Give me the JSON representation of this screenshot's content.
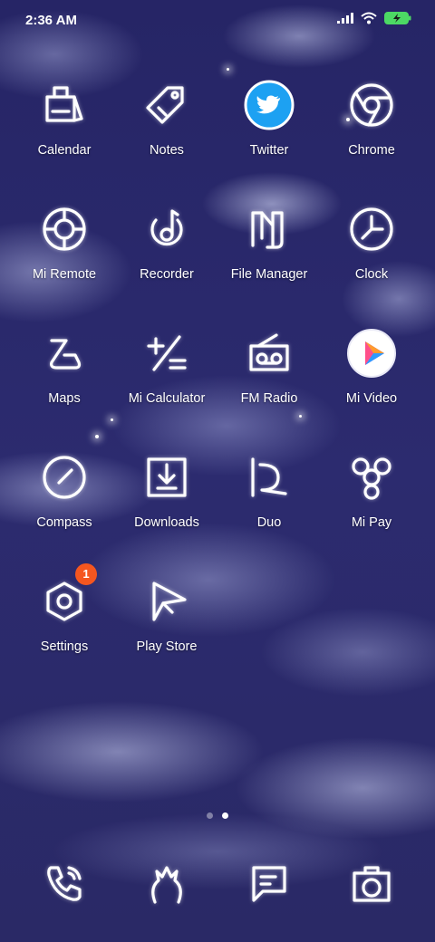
{
  "status_bar": {
    "time": "2:36 AM"
  },
  "apps": [
    {
      "label": "Calendar"
    },
    {
      "label": "Notes"
    },
    {
      "label": "Twitter"
    },
    {
      "label": "Chrome"
    },
    {
      "label": "Mi Remote"
    },
    {
      "label": "Recorder"
    },
    {
      "label": "File Manager"
    },
    {
      "label": "Clock"
    },
    {
      "label": "Maps"
    },
    {
      "label": "Mi Calculator"
    },
    {
      "label": "FM Radio"
    },
    {
      "label": "Mi Video"
    },
    {
      "label": "Compass"
    },
    {
      "label": "Downloads"
    },
    {
      "label": "Duo"
    },
    {
      "label": "Mi Pay"
    },
    {
      "label": "Settings",
      "badge": "1"
    },
    {
      "label": "Play Store"
    }
  ],
  "dock": [
    {
      "icon": "phone-icon"
    },
    {
      "icon": "themes-icon"
    },
    {
      "icon": "messages-icon"
    },
    {
      "icon": "camera-icon"
    }
  ],
  "page_indicator": {
    "pages": 2,
    "current": 2
  },
  "colors": {
    "badge": "#f5561f",
    "twitter": "#1da1f2",
    "wallpaper": "#2a2a6a"
  }
}
